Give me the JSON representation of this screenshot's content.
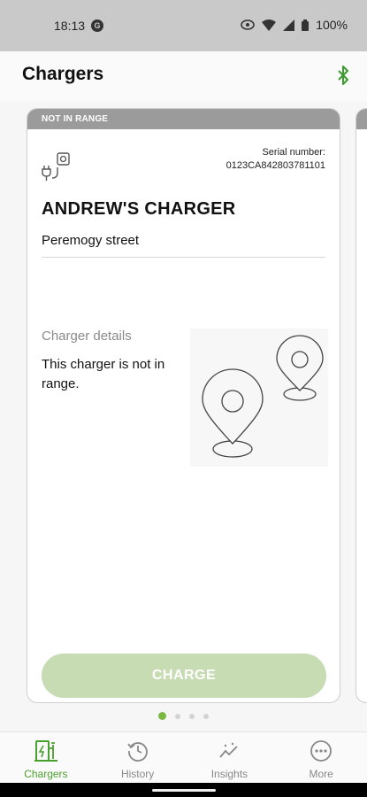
{
  "status": {
    "time": "18:13",
    "battery": "100%"
  },
  "appbar": {
    "title": "Chargers",
    "bluetooth_icon": "bluetooth-icon"
  },
  "card": {
    "header": "NOT IN RANGE",
    "serial_label": "Serial number:",
    "serial_value": "0123CA842803781101",
    "name": "ANDREW'S CHARGER",
    "street": "Peremogy street",
    "details_label": "Charger details",
    "details_text": "This charger is not in range.",
    "button": "CHARGE"
  },
  "pager": {
    "count": 4,
    "active": 0
  },
  "nav": {
    "items": [
      {
        "label": "Chargers",
        "icon": "charger-icon",
        "active": true
      },
      {
        "label": "History",
        "icon": "history-icon",
        "active": false
      },
      {
        "label": "Insights",
        "icon": "insights-icon",
        "active": false
      },
      {
        "label": "More",
        "icon": "more-icon",
        "active": false
      }
    ]
  },
  "colors": {
    "accent": "#7ab844",
    "header_gray": "#9b9b9b",
    "button_disabled": "#c8dcb3"
  }
}
